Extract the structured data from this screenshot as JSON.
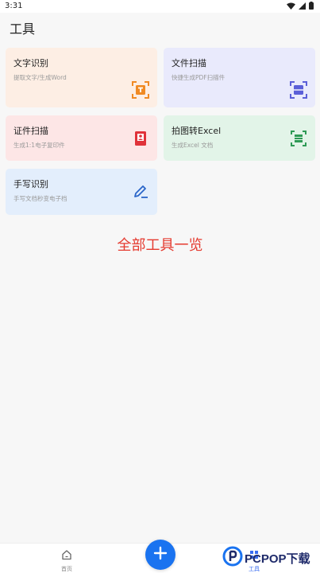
{
  "status_bar": {
    "time": "3:31"
  },
  "header": {
    "title": "工具"
  },
  "tools": [
    {
      "title": "文字识别",
      "subtitle": "提取文字/生成Word",
      "icon": "text-scan-icon",
      "bg": "#fdeee4",
      "accent": "#f08a24"
    },
    {
      "title": "文件扫描",
      "subtitle": "快捷生成PDF扫描件",
      "icon": "document-scan-icon",
      "bg": "#e9eafc",
      "accent": "#5b5fd8"
    },
    {
      "title": "证件扫描",
      "subtitle": "生成1:1电子复印件",
      "icon": "id-card-icon",
      "bg": "#fde6e6",
      "accent": "#e0323a"
    },
    {
      "title": "拍图转Excel",
      "subtitle": "生成Excel 文档",
      "icon": "excel-scan-icon",
      "bg": "#e2f4e8",
      "accent": "#2e9a55"
    },
    {
      "title": "手写识别",
      "subtitle": "手写文档秒变电子档",
      "icon": "handwriting-icon",
      "bg": "#e3eefc",
      "accent": "#2b66c9"
    }
  ],
  "caption": "全部工具一览",
  "bottom_nav": {
    "home_label": "首页",
    "tools_label": "工具"
  },
  "watermark": {
    "text": "PCPOP下载"
  },
  "colors": {
    "fab": "#1a73f0",
    "caption": "#e53a2f",
    "nav_active": "#3a6df0"
  }
}
